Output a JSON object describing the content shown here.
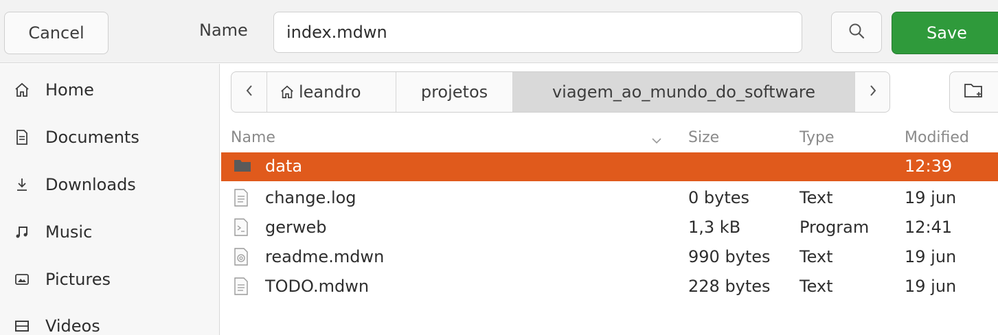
{
  "header": {
    "cancel_label": "Cancel",
    "name_label": "Name",
    "filename_value": "index.mdwn",
    "save_label": "Save"
  },
  "sidebar": {
    "items": [
      {
        "label": "Home",
        "icon": "home-icon"
      },
      {
        "label": "Documents",
        "icon": "document-icon"
      },
      {
        "label": "Downloads",
        "icon": "download-icon"
      },
      {
        "label": "Music",
        "icon": "music-icon"
      },
      {
        "label": "Pictures",
        "icon": "picture-icon"
      },
      {
        "label": "Videos",
        "icon": "video-icon"
      }
    ]
  },
  "pathbar": {
    "segments": [
      "leandro",
      "projetos",
      "viagem_ao_mundo_do_software"
    ],
    "active_index": 2
  },
  "list": {
    "columns": [
      "Name",
      "Size",
      "Type",
      "Modified"
    ],
    "rows": [
      {
        "name": "data",
        "size": "",
        "type": "",
        "modified": "12:39",
        "kind": "folder",
        "selected": true
      },
      {
        "name": "change.log",
        "size": "0 bytes",
        "type": "Text",
        "modified": "19 jun",
        "kind": "text"
      },
      {
        "name": "gerweb",
        "size": "1,3 kB",
        "type": "Program",
        "modified": "12:41",
        "kind": "program"
      },
      {
        "name": "readme.mdwn",
        "size": "990 bytes",
        "type": "Text",
        "modified": "19 jun",
        "kind": "text-alt"
      },
      {
        "name": "TODO.mdwn",
        "size": "228 bytes",
        "type": "Text",
        "modified": "19 jun",
        "kind": "text"
      }
    ]
  },
  "colors": {
    "accent_selection": "#e05a1c",
    "save_green": "#2f9a3b"
  }
}
